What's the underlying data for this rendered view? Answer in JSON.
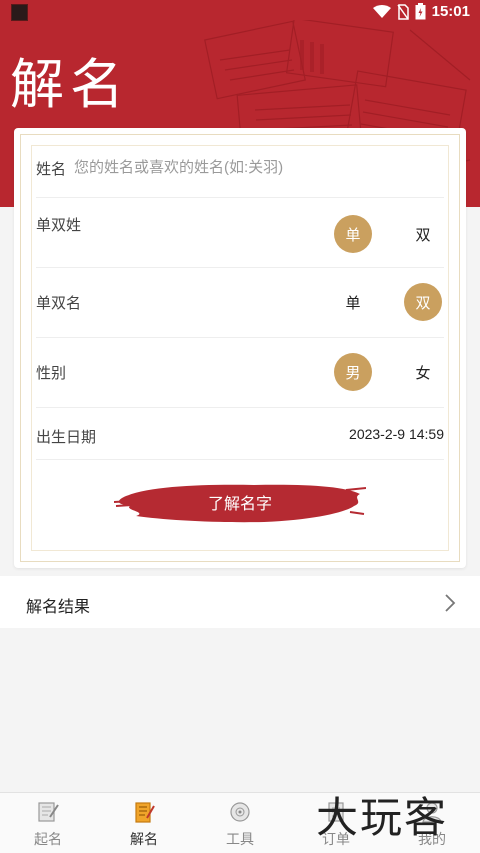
{
  "status_bar": {
    "time": "15:01"
  },
  "header": {
    "title": "解名"
  },
  "form": {
    "name": {
      "label": "姓名",
      "placeholder": "您的姓名或喜欢的姓名(如:关羽)",
      "value": ""
    },
    "surname_type": {
      "label": "单双姓",
      "options": [
        "单",
        "双"
      ],
      "selected": "单"
    },
    "given_type": {
      "label": "单双名",
      "options": [
        "单",
        "双"
      ],
      "selected": "双"
    },
    "gender": {
      "label": "性别",
      "options": [
        "男",
        "女"
      ],
      "selected": "男"
    },
    "birth_date": {
      "label": "出生日期",
      "value": "2023-2-9 14:59"
    },
    "submit_label": "了解名字"
  },
  "result": {
    "label": "解名结果"
  },
  "bottom_nav": [
    {
      "label": "起名",
      "icon": "naming-book-icon",
      "active": false
    },
    {
      "label": "解名",
      "icon": "interpret-name-icon",
      "active": true
    },
    {
      "label": "工具",
      "icon": "compass-tool-icon",
      "active": false
    },
    {
      "label": "订单",
      "icon": "order-icon",
      "active": false
    },
    {
      "label": "我的",
      "icon": "profile-icon",
      "active": false
    }
  ],
  "watermark": "大玩客",
  "colors": {
    "brand_red": "#b8272f",
    "gold": "#caa05f",
    "brush_red": "#b52a32"
  }
}
